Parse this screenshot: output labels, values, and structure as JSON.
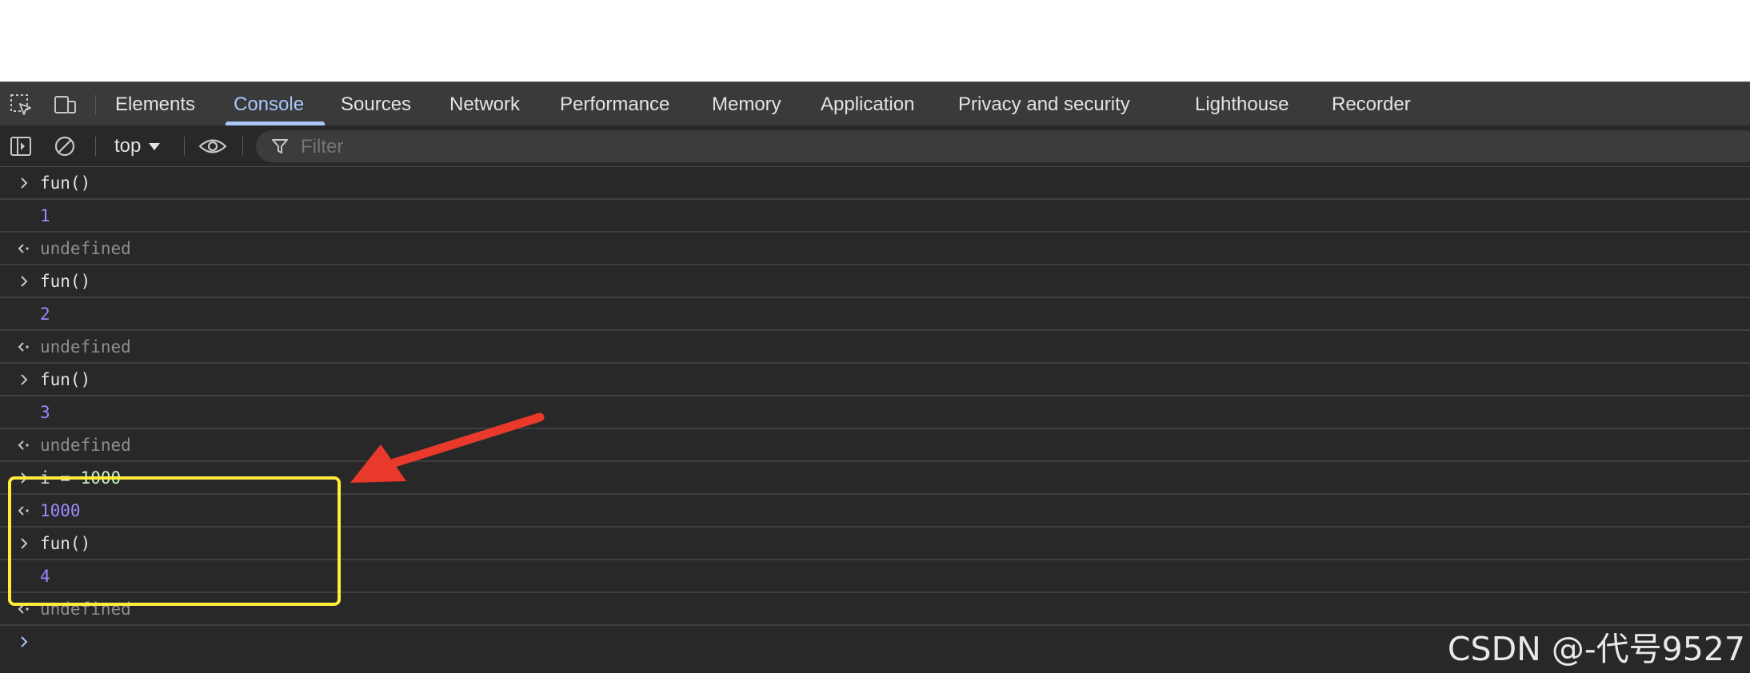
{
  "tabs": [
    {
      "label": "Elements",
      "active": false
    },
    {
      "label": "Console",
      "active": true
    },
    {
      "label": "Sources",
      "active": false
    },
    {
      "label": "Network",
      "active": false
    },
    {
      "label": "Performance",
      "active": false
    },
    {
      "label": "Memory",
      "active": false
    },
    {
      "label": "Application",
      "active": false
    },
    {
      "label": "Privacy and security",
      "active": false
    },
    {
      "label": "Lighthouse",
      "active": false
    },
    {
      "label": "Recorder",
      "active": false
    }
  ],
  "toolbar": {
    "context": "top",
    "filter_placeholder": "Filter"
  },
  "console_rows": [
    {
      "kind": "input",
      "text": "fun()"
    },
    {
      "kind": "log",
      "text": "1"
    },
    {
      "kind": "result",
      "text": "undefined"
    },
    {
      "kind": "input",
      "text": "fun()"
    },
    {
      "kind": "log",
      "text": "2"
    },
    {
      "kind": "result",
      "text": "undefined"
    },
    {
      "kind": "input",
      "text": "fun()"
    },
    {
      "kind": "log",
      "text": "3"
    },
    {
      "kind": "result",
      "text": "undefined"
    },
    {
      "kind": "input",
      "text_prefix": "i = ",
      "text_value": "1000"
    },
    {
      "kind": "result",
      "text": "1000"
    },
    {
      "kind": "input",
      "text": "fun()"
    },
    {
      "kind": "log",
      "text": "4"
    },
    {
      "kind": "result",
      "text": "undefined"
    }
  ],
  "annotation": {
    "highlight_color": "#ffeb3b",
    "arrow_color": "#e8392b"
  },
  "watermark": "CSDN @-代号9527",
  "colors": {
    "panel_bg": "#282828",
    "tabbar_bg": "#3a3a3a",
    "active_tab": "#a8c7fa",
    "number": "#9e87ff",
    "undefined": "#8e8e8e"
  }
}
